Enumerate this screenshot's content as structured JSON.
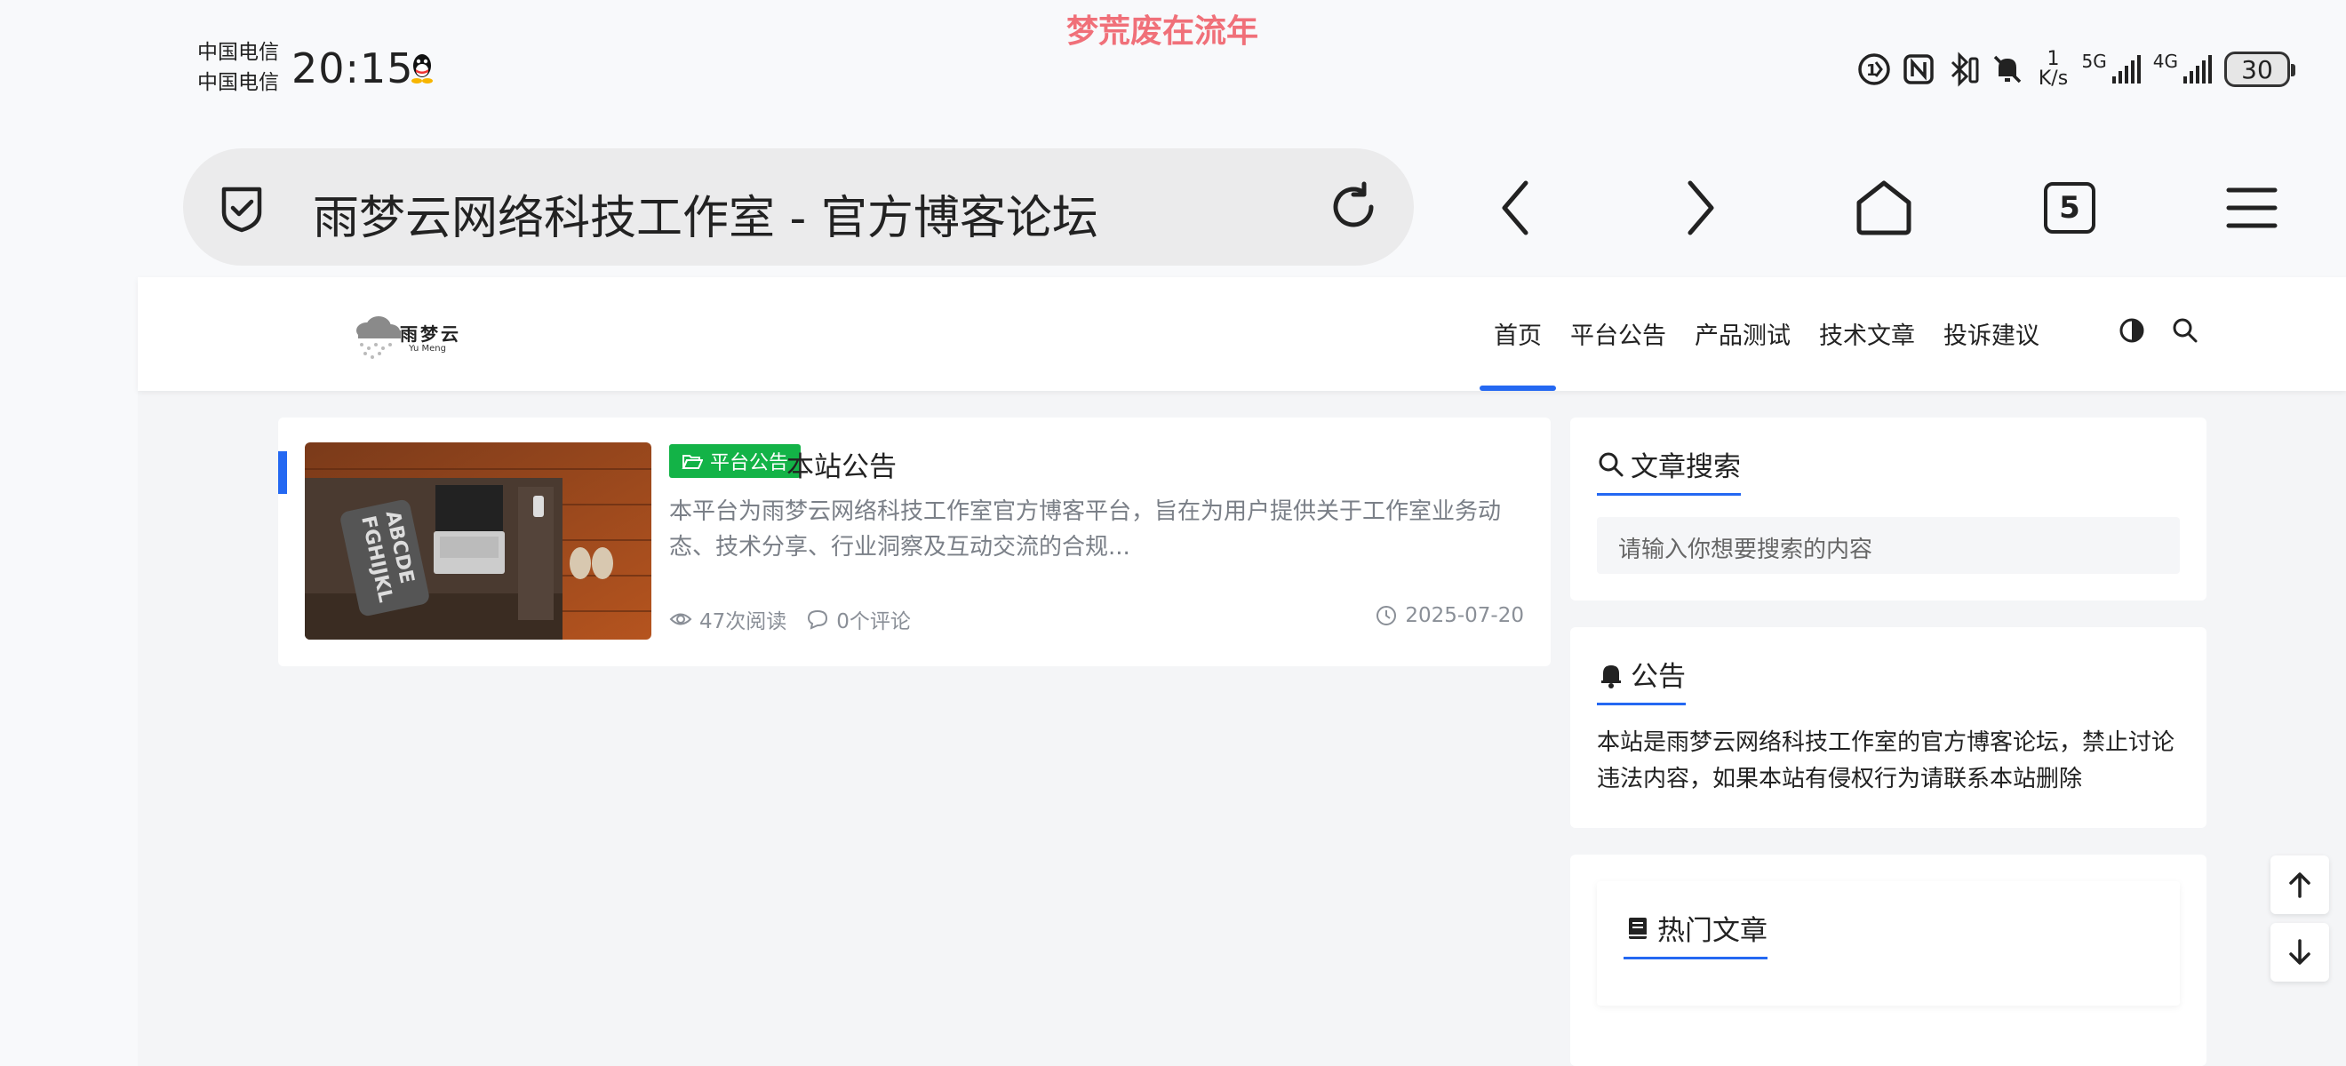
{
  "status_bar": {
    "carrier_1": "中国电信",
    "carrier_2": "中国电信",
    "time": "20:15",
    "marquee": "梦荒废在流年",
    "net_speed_value": "1",
    "net_speed_unit": "K/s",
    "signal_1_label": "5G",
    "signal_2_label": "4G",
    "battery": "30",
    "icons": [
      "qq-icon",
      "sim-1-icon",
      "nfc-icon",
      "bluetooth-icon",
      "vibrate-icon",
      "mute-icon",
      "signal-icon",
      "battery-icon"
    ]
  },
  "browser": {
    "page_title": "雨梦云网络科技工作室 - 官方博客论坛",
    "tab_count": "5",
    "icons": [
      "shield-check-icon",
      "reload-icon",
      "back-icon",
      "forward-icon",
      "home-icon",
      "tabs-icon",
      "menu-icon"
    ]
  },
  "site": {
    "logo_text": "雨梦云",
    "logo_sub": "Yu Meng",
    "nav": [
      "首页",
      "平台公告",
      "产品测试",
      "技术文章",
      "投诉建议"
    ],
    "active_nav": "首页",
    "accent_color": "#2468f2"
  },
  "post": {
    "category": "平台公告",
    "category_color": "#13b347",
    "title": "本站公告",
    "excerpt": "本平台为雨梦云网络科技工作室官方博客平台，旨在为用户提供关于工作室业务动态、技术分享、行业洞察及互动交流的合规...",
    "views": "47次阅读",
    "comments": "0个评论",
    "date": "2025-07-20"
  },
  "sidebar": {
    "search_title": "文章搜索",
    "search_placeholder": "请输入你想要搜索的内容",
    "notice_title": "公告",
    "notice_text": "本站是雨梦云网络科技工作室的官方博客论坛，禁止讨论违法内容，如果本站有侵权行为请联系本站删除",
    "hot_title": "热门文章"
  }
}
